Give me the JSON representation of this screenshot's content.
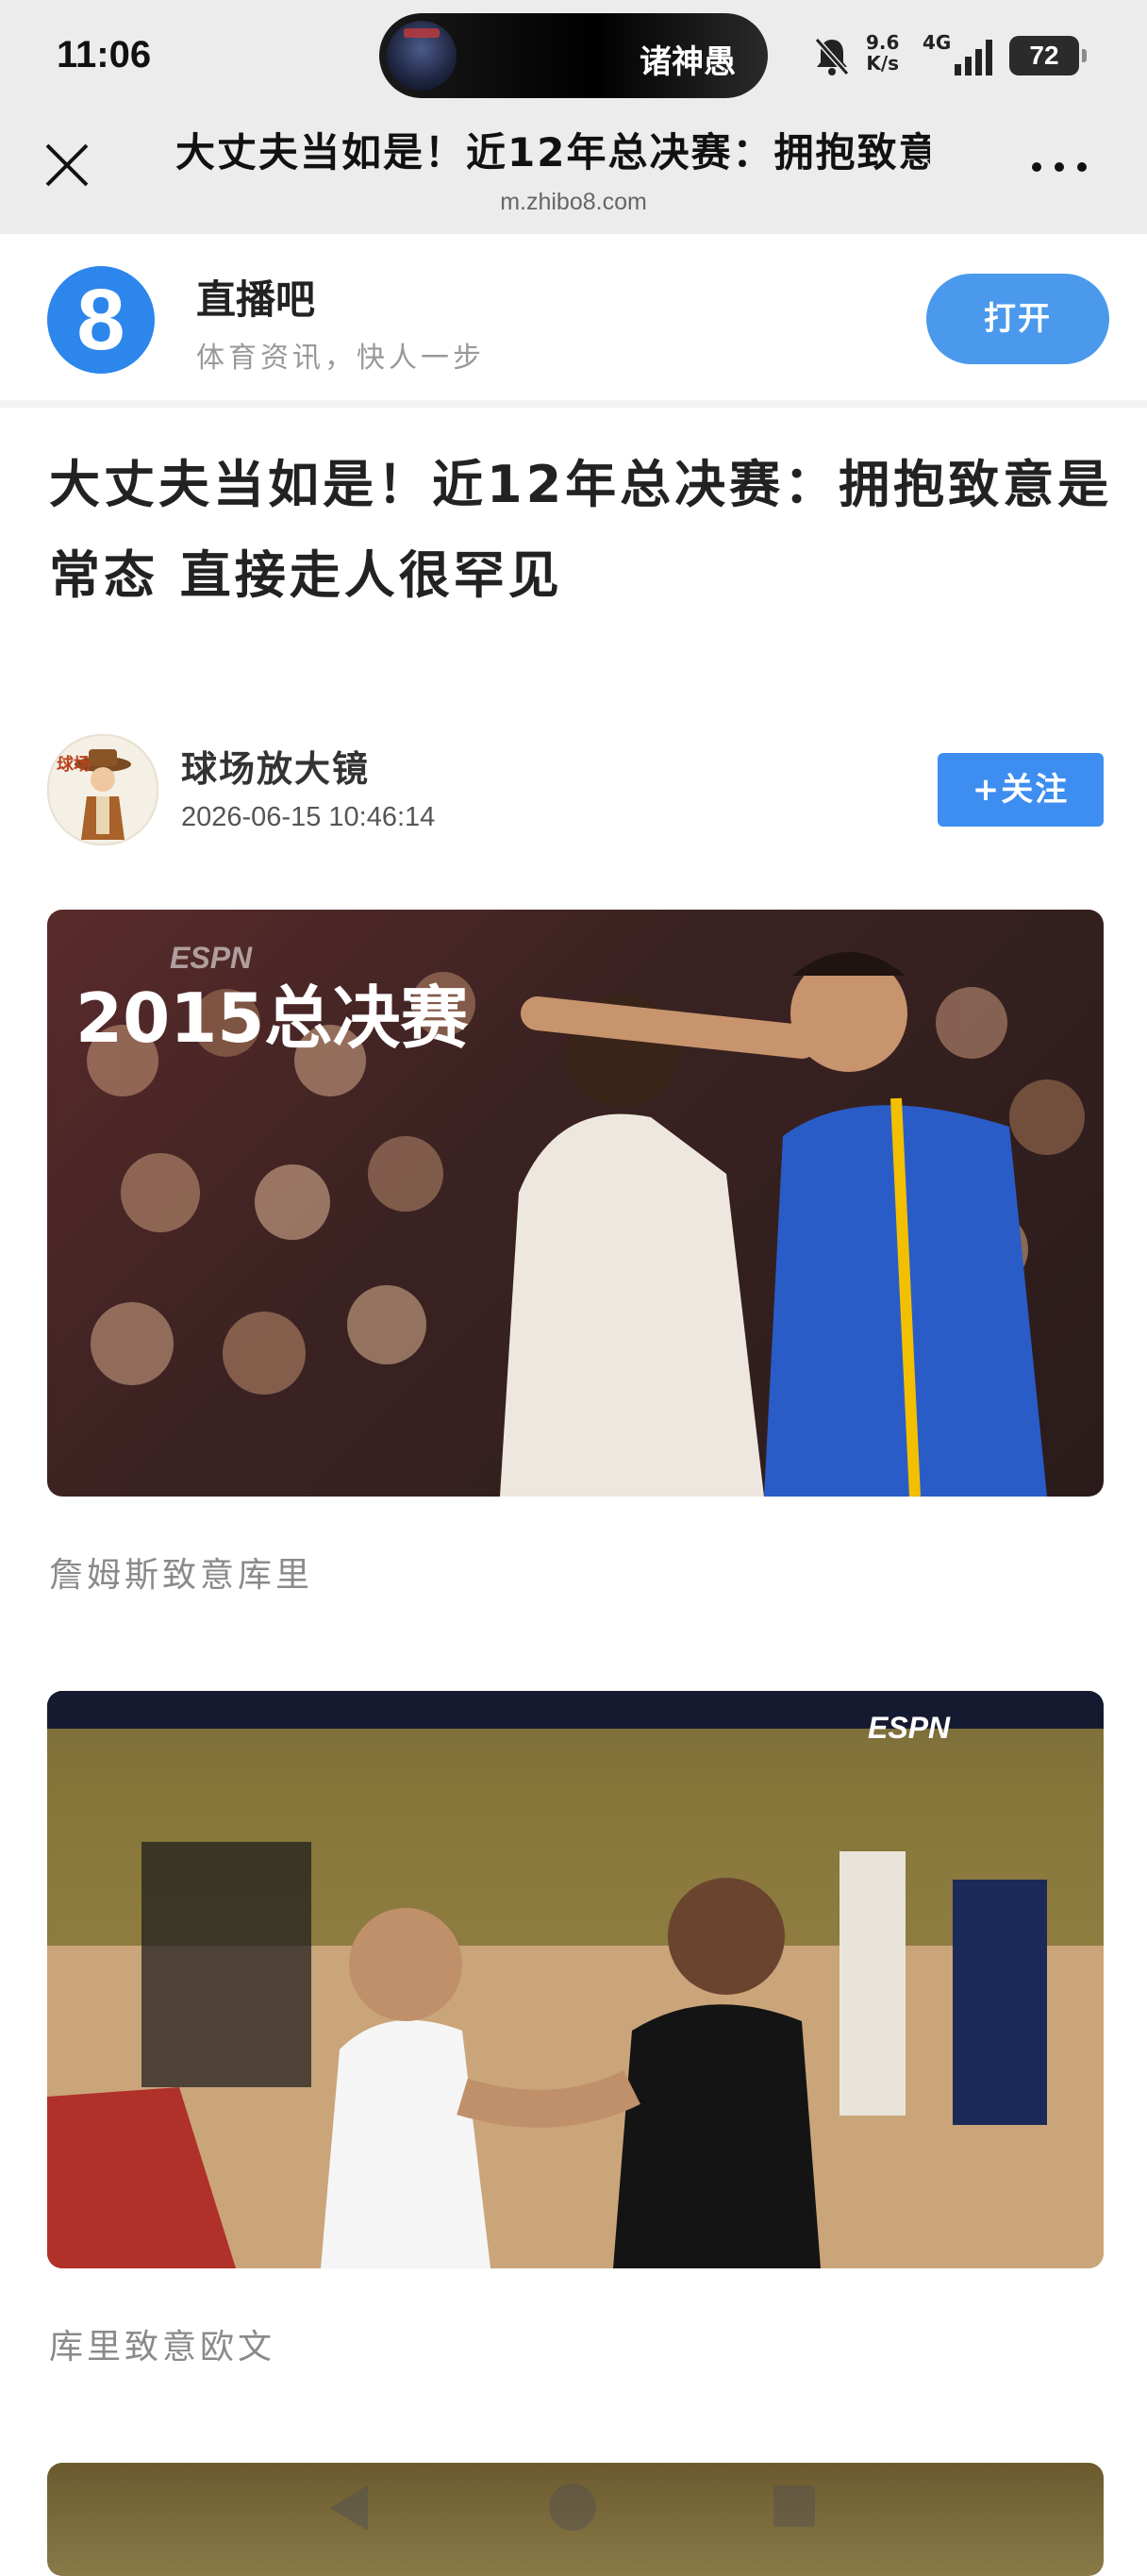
{
  "status_bar": {
    "time": "11:06",
    "island_label": "诸神愚",
    "net_speed_value": "9.6",
    "net_speed_unit": "K/s",
    "network": "4G",
    "battery": "72",
    "icons": [
      "mute-bell-icon",
      "signal-bars-icon",
      "battery-icon"
    ]
  },
  "browser": {
    "title": "大丈夫当如是！近12年总决赛：拥抱致意是常态 直接走人很罕见",
    "url": "m.zhibo8.com",
    "icons": [
      "close-icon",
      "more-dots-icon"
    ]
  },
  "app_banner": {
    "logo_text": "8",
    "name": "直播吧",
    "slogan": "体育资讯，快人一步",
    "open_label": "打开",
    "accent_color": "#4a99ec"
  },
  "article": {
    "title": "大丈夫当如是！近12年总决赛：拥抱致意是常态 直接走人很罕见",
    "author": {
      "name": "球场放大镜",
      "time": "2026-06-15 10:46:14",
      "follow_label": "+关注",
      "avatar_text": "球场"
    },
    "sections": [
      {
        "image_overlay": "2015总决赛",
        "image_logo": "ESPN",
        "caption": "詹姆斯致意库里"
      },
      {
        "image_overlay": "",
        "image_logo": "ESPN",
        "caption": "库里致意欧文"
      }
    ]
  },
  "nav_bar": {
    "icons": [
      "nav-back-icon",
      "nav-home-icon",
      "nav-recent-icon"
    ]
  }
}
